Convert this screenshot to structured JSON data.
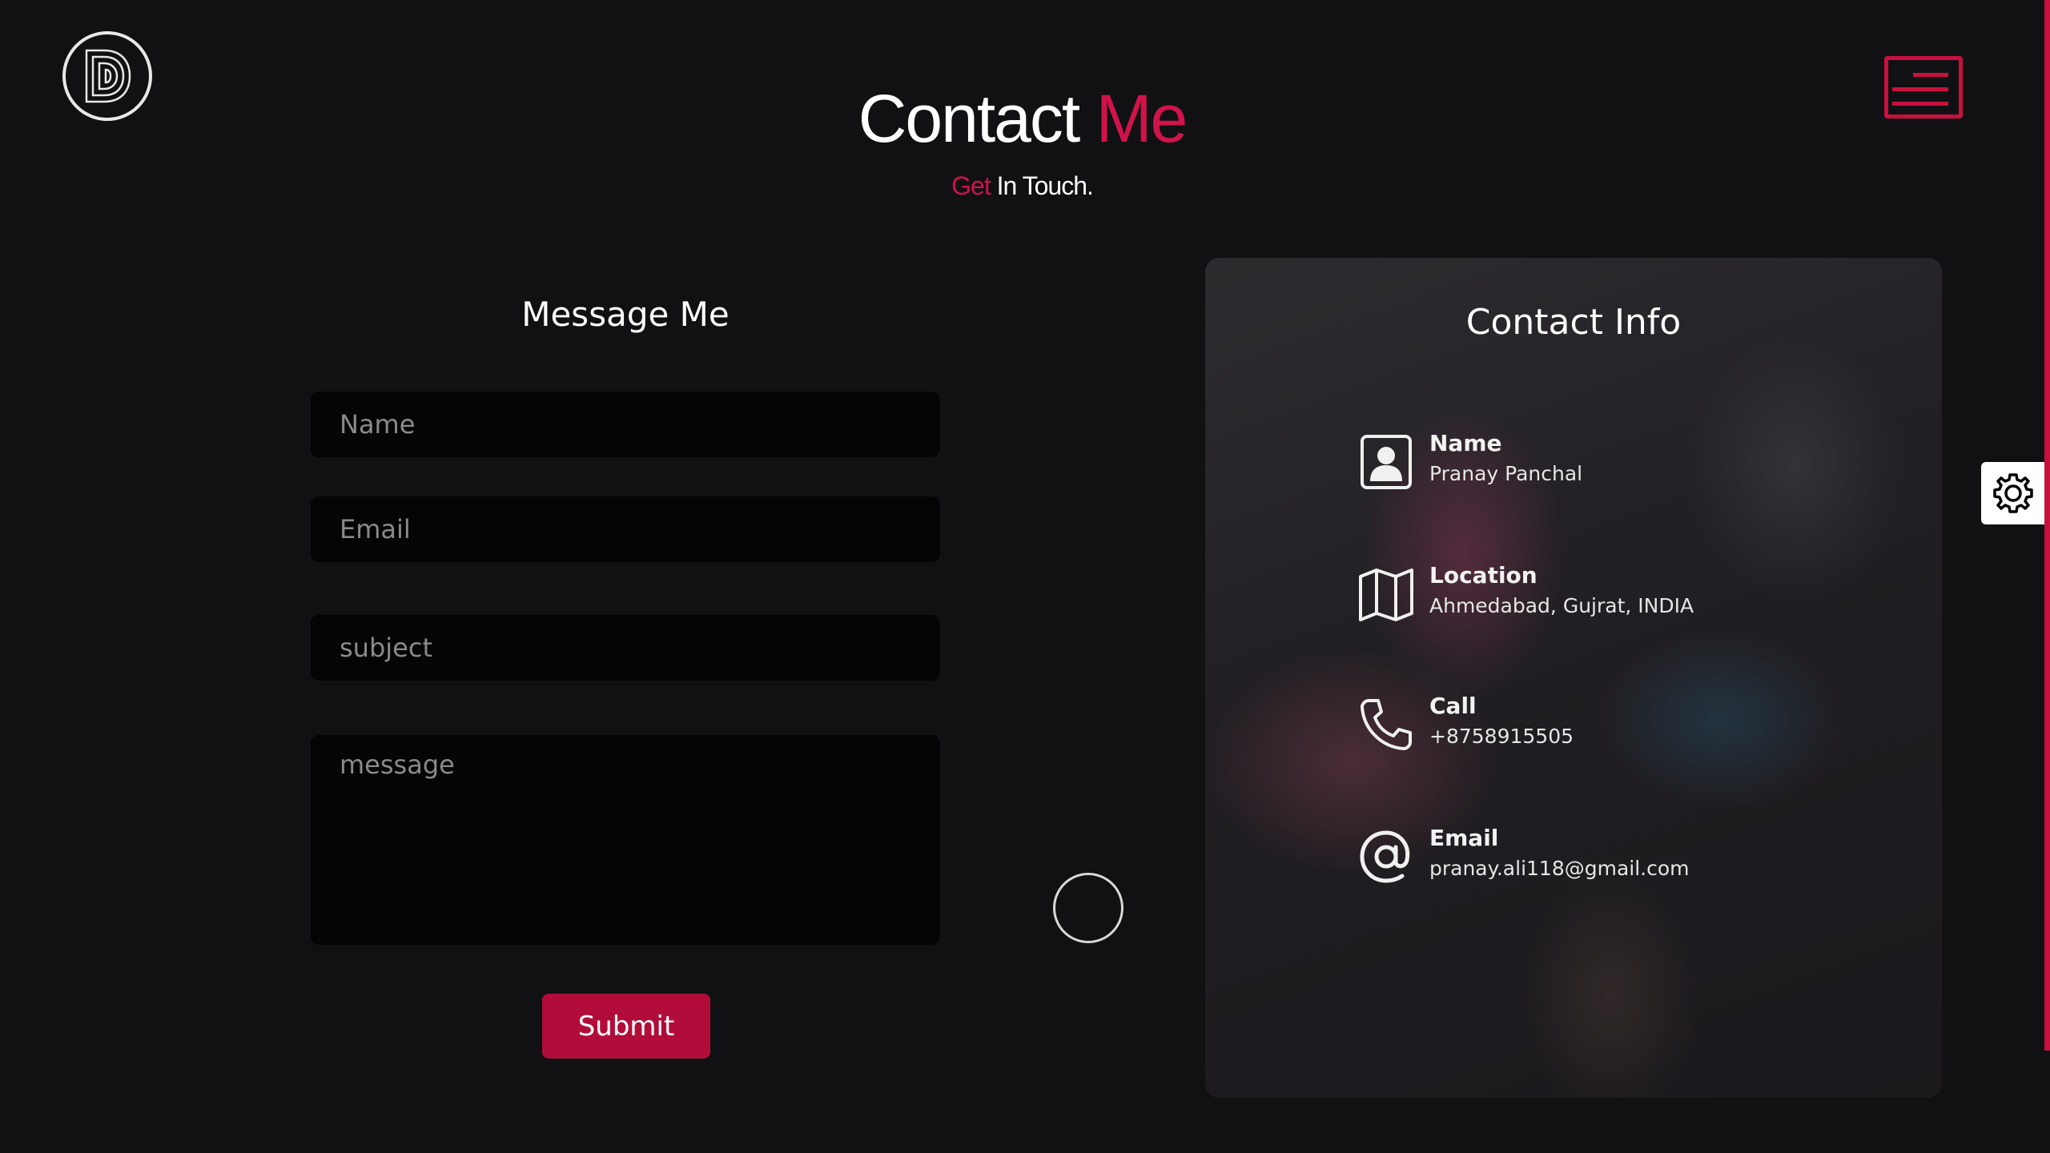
{
  "header": {
    "title_main": "Contact",
    "title_accent": "Me",
    "subtitle_accent": "Get",
    "subtitle_rest": "In Touch."
  },
  "form": {
    "title": "Message Me",
    "name_placeholder": "Name",
    "email_placeholder": "Email",
    "subject_placeholder": "subject",
    "message_placeholder": "message",
    "submit_label": "Submit"
  },
  "contact_info": {
    "title": "Contact Info",
    "items": [
      {
        "label": "Name",
        "value": "Pranay Panchal",
        "icon": "user-icon"
      },
      {
        "label": "Location",
        "value": "Ahmedabad, Gujrat, INDIA",
        "icon": "map-icon"
      },
      {
        "label": "Call",
        "value": "+8758915505",
        "icon": "phone-icon"
      },
      {
        "label": "Email",
        "value": "pranay.ali118@gmail.com",
        "icon": "at-sign-icon"
      }
    ]
  },
  "colors": {
    "accent": "#c8103f",
    "background": "#111113",
    "field_bg": "#050505"
  }
}
